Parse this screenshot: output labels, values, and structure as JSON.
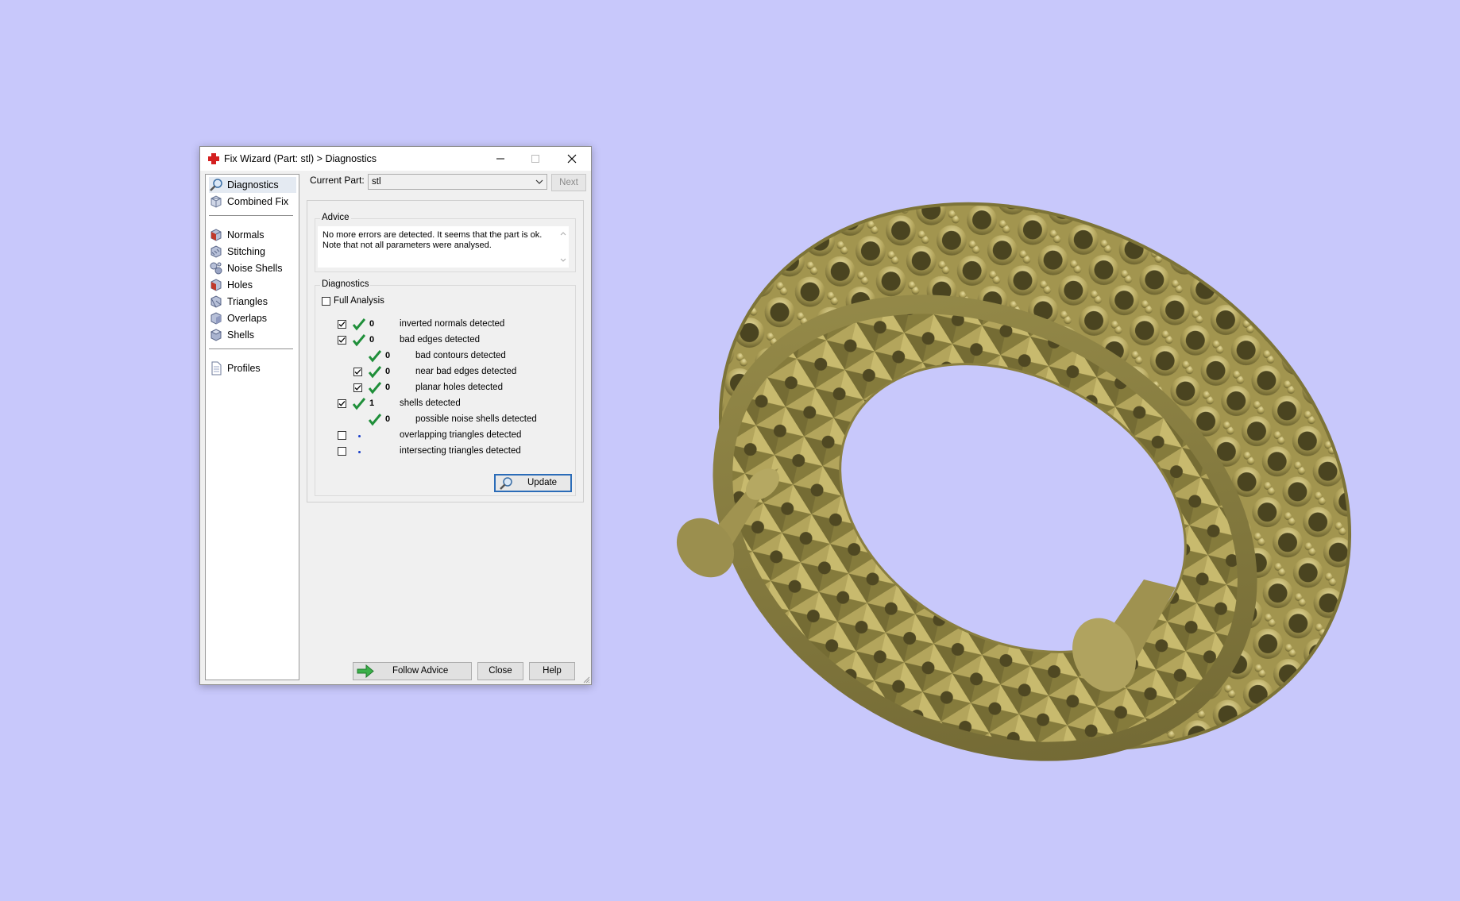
{
  "window": {
    "title": "Fix Wizard (Part: stl) > Diagnostics"
  },
  "nav": {
    "items": [
      {
        "label": "Diagnostics"
      },
      {
        "label": "Combined Fix"
      },
      {
        "label": "Normals"
      },
      {
        "label": "Stitching"
      },
      {
        "label": "Noise Shells"
      },
      {
        "label": "Holes"
      },
      {
        "label": "Triangles"
      },
      {
        "label": "Overlaps"
      },
      {
        "label": "Shells"
      },
      {
        "label": "Profiles"
      }
    ]
  },
  "header": {
    "current_part_label": "Current Part:",
    "current_part_value": "stl",
    "next_label": "Next"
  },
  "advice": {
    "title": "Advice",
    "text": "No more errors are detected. It seems that the part is ok.\nNote that not all parameters were analysed."
  },
  "diagnostics": {
    "title": "Diagnostics",
    "full_analysis_label": "Full Analysis",
    "rows": [
      {
        "count": "0",
        "label": "inverted normals detected"
      },
      {
        "count": "0",
        "label": "bad edges detected"
      },
      {
        "count": "0",
        "label": "bad contours detected"
      },
      {
        "count": "0",
        "label": "near bad edges detected"
      },
      {
        "count": "0",
        "label": "planar holes detected"
      },
      {
        "count": "1",
        "label": "shells detected"
      },
      {
        "count": "0",
        "label": "possible noise shells detected"
      },
      {
        "count": "",
        "label": "overlapping triangles detected"
      },
      {
        "count": "",
        "label": "intersecting triangles detected"
      }
    ],
    "update_label": "Update"
  },
  "footer": {
    "follow_advice_label": "Follow Advice",
    "close_label": "Close",
    "help_label": "Help"
  },
  "colors": {
    "background": "#c8c8fb",
    "model_gold": "#a89a52",
    "check_green": "#1f8f3a"
  }
}
